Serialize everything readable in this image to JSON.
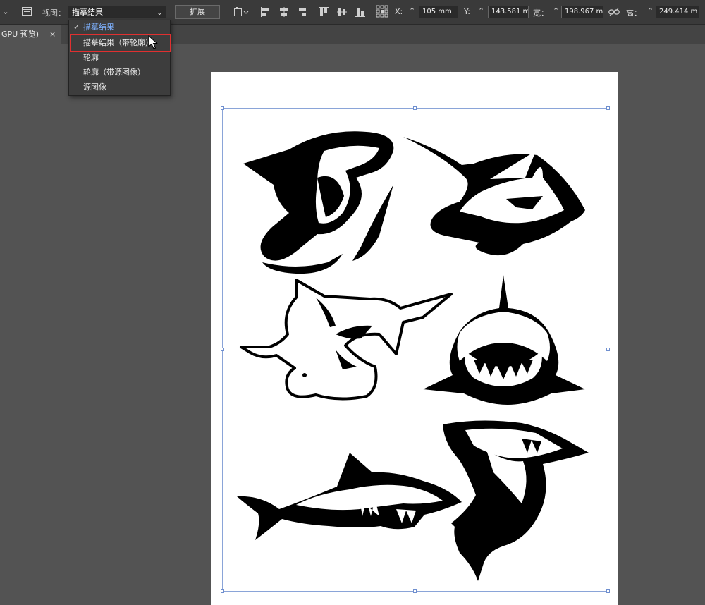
{
  "control_bar": {
    "view_label": "视图：",
    "view_value": "描摹结果",
    "expand_label": "扩展",
    "x_label": "X:",
    "x_value": "105 mm",
    "y_label": "Y:",
    "y_value": "143.581 m",
    "width_label": "宽：",
    "width_value": "198.967 m",
    "height_label": "高：",
    "height_value": "249.414 m"
  },
  "tab": {
    "title": "GPU 预览)",
    "close": "×"
  },
  "view_menu": {
    "items": [
      {
        "label": "描摹结果",
        "selected": true
      },
      {
        "label": "描摹结果（带轮廓）",
        "selected": false
      },
      {
        "label": "轮廓",
        "selected": false
      },
      {
        "label": "轮廓（带源图像）",
        "selected": false
      },
      {
        "label": "源图像",
        "selected": false
      }
    ],
    "check": "✓"
  },
  "colors": {
    "accent": "#7fb2ff",
    "highlight": "#e03030",
    "selection": "#8aa4d8"
  },
  "icons": [
    "menu-chevron-icon",
    "document-setup-icon",
    "shape-options-icon",
    "align-left-icon",
    "align-center-h-icon",
    "align-right-icon",
    "align-top-icon",
    "align-center-v-icon",
    "align-bottom-icon",
    "reference-point-icon",
    "link-proportions-icon",
    "spinner-icon",
    "cursor-icon"
  ]
}
